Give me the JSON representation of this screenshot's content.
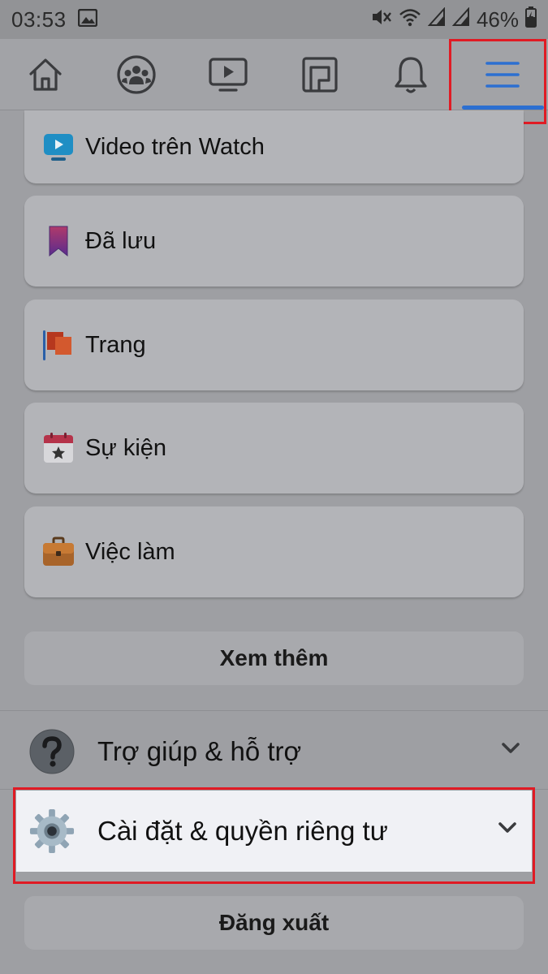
{
  "status": {
    "time": "03:53",
    "battery": "46%"
  },
  "tabs": [
    {
      "name": "home",
      "icon": "home-icon"
    },
    {
      "name": "groups",
      "icon": "groups-icon"
    },
    {
      "name": "watch",
      "icon": "video-icon"
    },
    {
      "name": "marketplace",
      "icon": "marketplace-icon"
    },
    {
      "name": "notifications",
      "icon": "bell-icon"
    },
    {
      "name": "menu",
      "icon": "hamburger-menu-icon",
      "active": true
    }
  ],
  "menu_items": [
    {
      "label": "Video trên Watch",
      "icon": "watch-video-icon"
    },
    {
      "label": "Đã lưu",
      "icon": "bookmark-icon"
    },
    {
      "label": "Trang",
      "icon": "flag-icon"
    },
    {
      "label": "Sự kiện",
      "icon": "calendar-star-icon"
    },
    {
      "label": "Việc làm",
      "icon": "briefcase-icon"
    }
  ],
  "see_more_label": "Xem thêm",
  "help_section": {
    "label": "Trợ giúp & hỗ trợ",
    "icon": "question-icon"
  },
  "settings_section": {
    "label": "Cài đặt & quyền riêng tư",
    "icon": "gear-icon"
  },
  "logout_label": "Đăng xuất",
  "colors": {
    "accent": "#2c6fd1",
    "highlight": "#e01b24"
  }
}
